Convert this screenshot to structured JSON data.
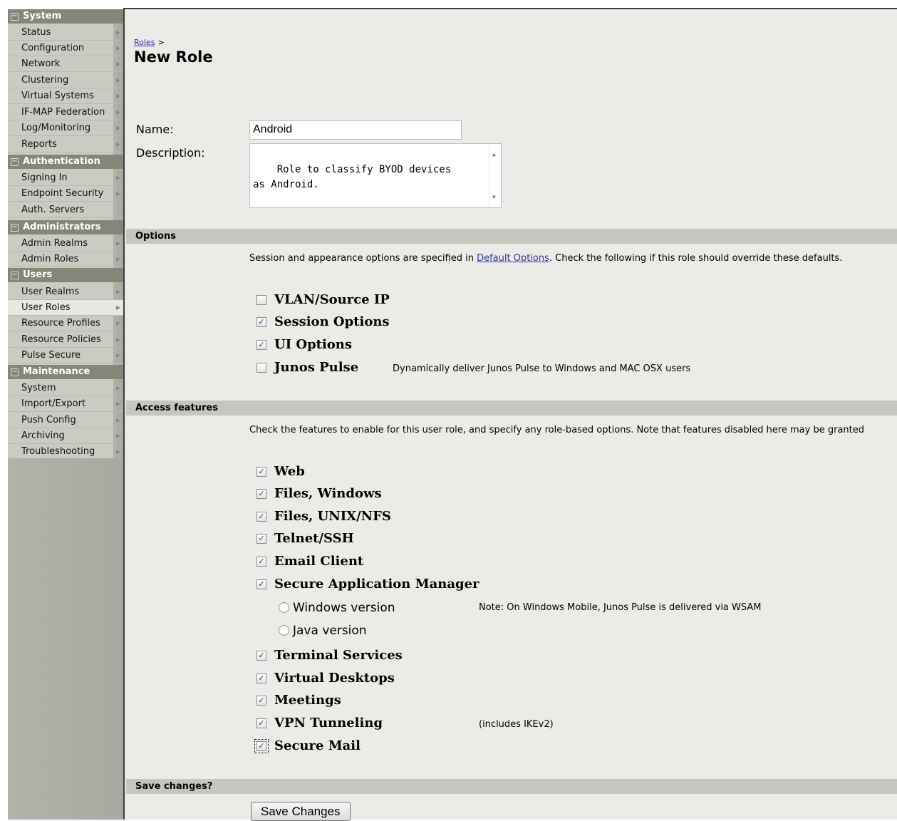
{
  "sidebar": {
    "sections": [
      {
        "title": "System",
        "items": [
          "Status",
          "Configuration",
          "Network",
          "Clustering",
          "Virtual Systems",
          "IF-MAP Federation",
          "Log/Monitoring",
          "Reports"
        ]
      },
      {
        "title": "Authentication",
        "items": [
          "Signing In",
          "Endpoint Security",
          "Auth. Servers"
        ]
      },
      {
        "title": "Administrators",
        "items": [
          "Admin Realms",
          "Admin Roles"
        ]
      },
      {
        "title": "Users",
        "items": [
          "User Realms",
          "User Roles",
          "Resource Profiles",
          "Resource Policies",
          "Pulse Secure"
        ]
      },
      {
        "title": "Maintenance",
        "items": [
          "System",
          "Import/Export",
          "Push Config",
          "Archiving",
          "Troubleshooting"
        ]
      }
    ],
    "active_item": "User Roles"
  },
  "breadcrumb": {
    "link": "Roles",
    "separator": ">"
  },
  "page_title": "New Role",
  "form": {
    "name_label": "Name:",
    "name_value": "Android",
    "description_label": "Description:",
    "description_value": "Role to classify BYOD devices\nas Android."
  },
  "options": {
    "header": "Options",
    "desc_before": "Session and appearance options are specified in ",
    "desc_link": "Default Options",
    "desc_after": ". Check the following if this role should override these defaults.",
    "items": [
      {
        "label": "VLAN/Source IP",
        "checked": false
      },
      {
        "label": "Session Options",
        "checked": true
      },
      {
        "label": "UI Options",
        "checked": true
      },
      {
        "label": "Junos Pulse",
        "checked": false,
        "note": "Dynamically deliver Junos Pulse to Windows and MAC OSX users"
      }
    ]
  },
  "access": {
    "header": "Access features",
    "desc": "Check the features to enable for this user role, and specify any role-based options. Note that features disabled here may be granted",
    "items": [
      {
        "label": "Web",
        "checked": true
      },
      {
        "label": "Files, Windows",
        "checked": true
      },
      {
        "label": "Files, UNIX/NFS",
        "checked": true
      },
      {
        "label": "Telnet/SSH",
        "checked": true
      },
      {
        "label": "Email Client",
        "checked": true
      },
      {
        "label": "Secure Application Manager",
        "checked": true
      },
      {
        "label": "Terminal Services",
        "checked": true
      },
      {
        "label": "Virtual Desktops",
        "checked": true
      },
      {
        "label": "Meetings",
        "checked": true
      },
      {
        "label": "VPN Tunneling",
        "checked": true,
        "note": "(includes IKEv2)"
      },
      {
        "label": "Secure Mail",
        "checked": true
      }
    ],
    "sam_options": [
      {
        "label": "Windows version",
        "selected": false,
        "note": "Note: On Windows Mobile, Junos Pulse is delivered via WSAM"
      },
      {
        "label": "Java version",
        "selected": false
      }
    ]
  },
  "save": {
    "header": "Save changes?",
    "button_label": "Save Changes"
  }
}
